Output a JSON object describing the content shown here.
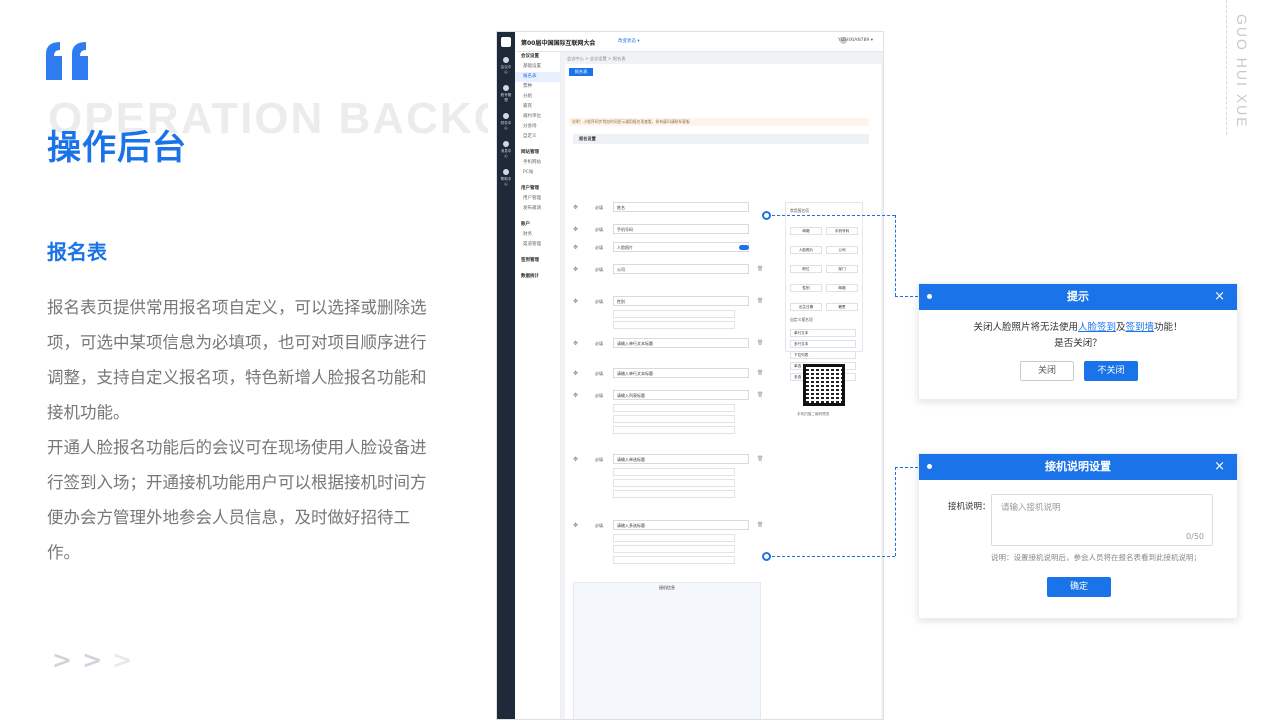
{
  "brand_color": "#1a73e8",
  "slide": {
    "bg_word": "OPERATION BACKG",
    "title": "操作后台",
    "subtitle": "报名表",
    "paragraph1": "报名表页提供常用报名项自定义，可以选择或删除选项，可选中某项信息为必填项，也可对项目顺序进行调整，支持自定义报名项，特色新增人脸报名功能和接机功能。",
    "paragraph2": "开通人脸报名功能后的会议可在现场使用人脸设备进行签到入场；开通接机功能用户可以根据接机时间方便办会方管理外地参会人员信息，及时做好招待工作。",
    "side_label": "GUO HUI XUE"
  },
  "app": {
    "title": "第00届中国国际互联网大会",
    "tag": "改变状态 ▾",
    "user": "YIZHIXIAN789 ▾",
    "rail": [
      "会议中心",
      "账号管理",
      "财务中心",
      "消息中心",
      "帮助中心"
    ],
    "menu": [
      {
        "label": "会议设置",
        "type": "grp"
      },
      {
        "label": "基础设置",
        "type": "item"
      },
      {
        "label": "报名表",
        "type": "act"
      },
      {
        "label": "票种",
        "type": "item"
      },
      {
        "label": "分组",
        "type": "item"
      },
      {
        "label": "嘉宾",
        "type": "item"
      },
      {
        "label": "邀约单位",
        "type": "item"
      },
      {
        "label": "分会场",
        "type": "item"
      },
      {
        "label": "自定义",
        "type": "item"
      },
      {
        "label": "网站管理",
        "type": "grp"
      },
      {
        "label": "手机网站",
        "type": "item"
      },
      {
        "label": "PC站",
        "type": "item"
      },
      {
        "label": "用户管理",
        "type": "grp"
      },
      {
        "label": "用户管理",
        "type": "item"
      },
      {
        "label": "发布邀请",
        "type": "item"
      },
      {
        "label": "账户",
        "type": "grp"
      },
      {
        "label": "财务",
        "type": "item"
      },
      {
        "label": "渠道管理",
        "type": "item"
      },
      {
        "label": "签到管理",
        "type": "grp"
      },
      {
        "label": "数据统计",
        "type": "grp"
      }
    ],
    "crumb": "会议中心 >  会议设置  >  报名表",
    "tab": "报名表",
    "alert": "说明：小程序同步到加时间显示通用报名项查看，如有疑问请联系客服",
    "section": "报名设置",
    "fields": [
      "姓名",
      "手机号码",
      "人脸照片",
      "公司",
      "性别",
      "请输入单行文本标题",
      "请输入单行文本标题",
      "请输入列表标题",
      "请输入单选标题",
      "请输入多选标题"
    ],
    "required_label": "必填",
    "palette_common": "常用报名项",
    "palette_chips": [
      "邮箱",
      "手机号码",
      "人脸照片",
      "公司",
      "职位",
      "部门",
      "性别",
      "邮箱",
      "出生日期",
      "籍贯"
    ],
    "palette_custom": "自定义报名项",
    "palette_custom_items": [
      "单行文本",
      "多行文本",
      "下拉列表",
      "单选",
      "多选"
    ],
    "qr_caption": "手机扫描二维码预览",
    "pickup_block": "接机信息"
  },
  "dialog_close": {
    "title": "提示",
    "close_icon": "×",
    "line1_pre": "关闭人脸照片将无法使用",
    "line1_link1": "人脸签到",
    "line1_mid": "及",
    "line1_link2": "签到墙",
    "line1_post": "功能！",
    "line2": "是否关闭？",
    "btn_close": "关闭",
    "btn_keep": "不关闭"
  },
  "dialog_pickup": {
    "title": "接机说明设置",
    "close_icon": "×",
    "label": "接机说明：",
    "placeholder": "请输入接机说明",
    "counter": "0/50",
    "note": "说明：设置接机说明后，参会人员将在报名表看到此接机说明；",
    "btn_ok": "确定"
  }
}
